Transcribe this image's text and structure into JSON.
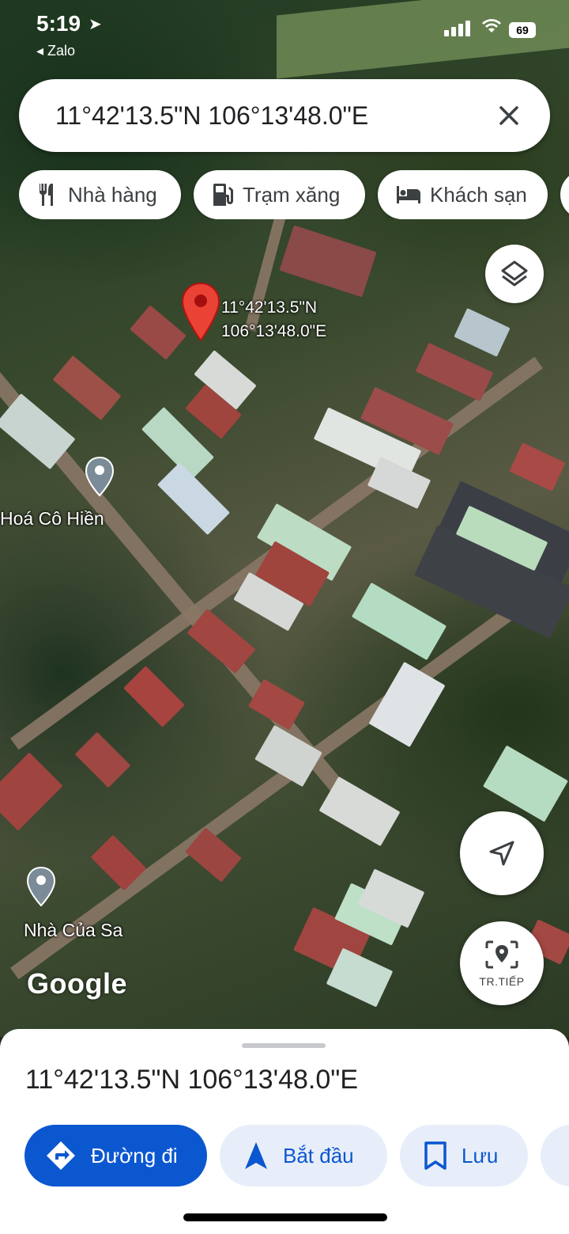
{
  "status_bar": {
    "time": "5:19",
    "back_app": "◂ Zalo",
    "battery": "69"
  },
  "search": {
    "query": "11°42'13.5\"N 106°13'48.0\"E"
  },
  "chips": [
    {
      "label": "Nhà hàng",
      "icon": "restaurant-icon"
    },
    {
      "label": "Trạm xăng",
      "icon": "gas-station-icon"
    },
    {
      "label": "Khách sạn",
      "icon": "hotel-icon"
    }
  ],
  "pin": {
    "line1": "11°42'13.5\"N",
    "line2": "106°13'48.0\"E"
  },
  "places": [
    {
      "label": "Hoá Cô Hiền"
    },
    {
      "label": "Nhà Của Sa"
    }
  ],
  "map": {
    "attribution": "Google",
    "live_view_label": "TR.TIẾP"
  },
  "sheet": {
    "title": "11°42'13.5\"N 106°13'48.0\"E",
    "actions": [
      {
        "label": "Đường đi",
        "icon": "directions-icon"
      },
      {
        "label": "Bắt đầu",
        "icon": "navigation-arrow-icon"
      },
      {
        "label": "Lưu",
        "icon": "bookmark-icon"
      }
    ]
  },
  "colors": {
    "accent": "#0b57d0",
    "pin": "#ea4335",
    "secondary_bg": "#e8eef9"
  }
}
